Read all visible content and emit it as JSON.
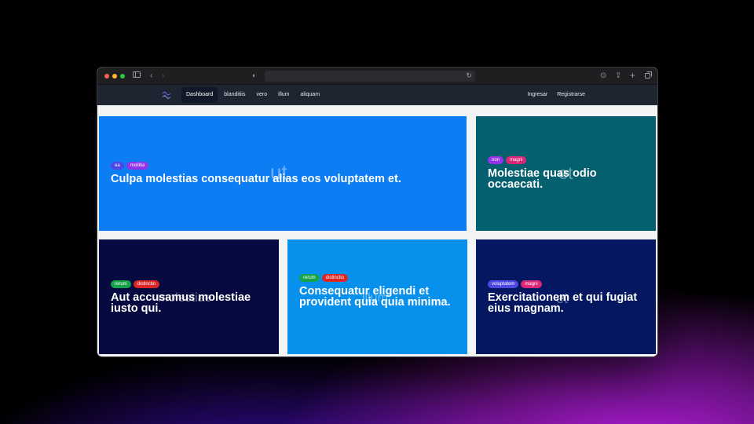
{
  "colors": {
    "card_1": "#0d7df4",
    "card_2": "#045f6e",
    "card_3": "#070a40",
    "card_4": "#0891ec",
    "card_5": "#051761",
    "tag_indigo": "#4f46e5",
    "tag_purple": "#9333ea",
    "tag_pink": "#db2777",
    "tag_green": "#16a34a",
    "tag_red": "#dc2626"
  },
  "browser": {
    "icons": [
      "sidebar-icon",
      "back-icon",
      "forward-icon",
      "shield-icon",
      "reload-icon",
      "download-icon",
      "share-icon",
      "new-tab-icon",
      "tabs-overview-icon"
    ]
  },
  "navbar": {
    "logo": "tailwind-logo-icon",
    "links": [
      "Dashboard",
      "blanditiis",
      "vero",
      "illum",
      "aliquam"
    ],
    "active": "Dashboard",
    "right": [
      "Ingresar",
      "Registrarse"
    ]
  },
  "cards": [
    {
      "tags": [
        {
          "label": "ea",
          "color": "indigo"
        },
        {
          "label": "mollitia",
          "color": "purple"
        }
      ],
      "title": "Culpa molestias consequatur alias eos voluptatem et.",
      "overlay": "ut"
    },
    {
      "tags": [
        {
          "label": "non",
          "color": "purple"
        },
        {
          "label": "magni",
          "color": "pink"
        }
      ],
      "title": "Molestiae quas odio occaecati.",
      "overlay": "et"
    },
    {
      "tags": [
        {
          "label": "rerum",
          "color": "green"
        },
        {
          "label": "distinctio",
          "color": "red"
        }
      ],
      "title": "Aut accusamus molestiae iusto qui.",
      "overlay": "molestiae"
    },
    {
      "tags": [
        {
          "label": "rerum",
          "color": "green"
        },
        {
          "label": "distinctio",
          "color": "red"
        }
      ],
      "title": "Consequatur eligendi et provident quia quia minima.",
      "overlay": "illum"
    },
    {
      "tags": [
        {
          "label": "voluptatem",
          "color": "indigo"
        },
        {
          "label": "magni",
          "color": "pink"
        }
      ],
      "title": "Exercitationem et qui fugiat eius magnam.",
      "overlay": "et"
    }
  ]
}
